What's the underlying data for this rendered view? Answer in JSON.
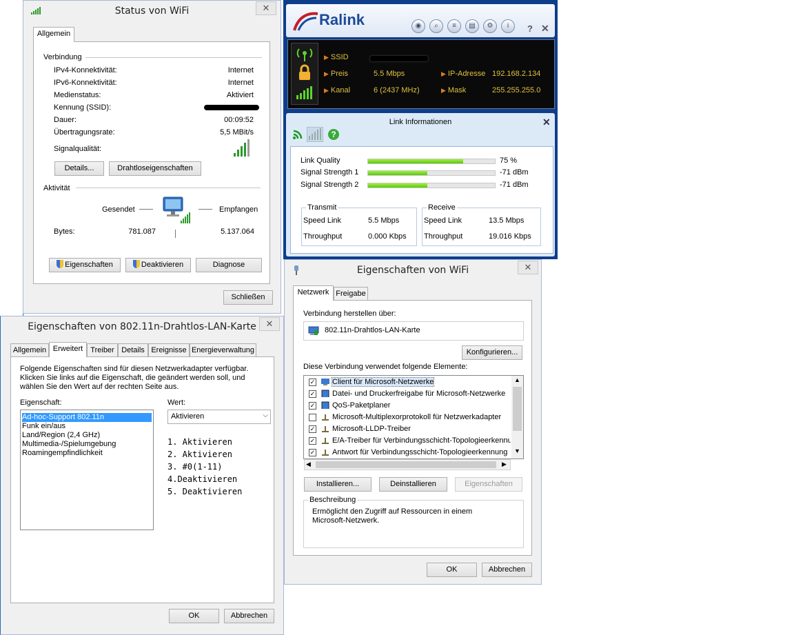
{
  "status_dialog": {
    "title": "Status von WiFi",
    "close": "✕",
    "tab": "Allgemein",
    "connection_heading": "Verbindung",
    "rows": [
      {
        "label": "IPv4-Konnektivität:",
        "value": "Internet"
      },
      {
        "label": "IPv6-Konnektivität:",
        "value": "Internet"
      },
      {
        "label": "Medienstatus:",
        "value": "Aktiviert"
      },
      {
        "label": "Kennung (SSID):",
        "value": ""
      },
      {
        "label": "Dauer:",
        "value": "00:09:52"
      },
      {
        "label": "Übertragungsrate:",
        "value": "5,5 MBit/s"
      }
    ],
    "signal_label": "Signalqualität:",
    "signal_bars": 4,
    "details_button": "Details...",
    "wireless_props_button": "Drahtloseigenschaften",
    "activity_heading": "Aktivität",
    "sent_label": "Gesendet",
    "received_label": "Empfangen",
    "bytes_label": "Bytes:",
    "bytes_sent": "781.087",
    "bytes_received": "5.137.064",
    "properties_button": "Eigenschaften",
    "disable_button": "Deaktivieren",
    "diagnose_button": "Diagnose",
    "close_button": "Schließen"
  },
  "ralink": {
    "brand": "Ralink",
    "toolbar_icons": [
      "rss-icon",
      "search-icon",
      "list-icon",
      "page-icon",
      "settings-icon",
      "info-icon"
    ],
    "help": "?",
    "close": "✕",
    "ssid_label": "SSID",
    "rate_label": "Preis",
    "rate_value": "5.5 Mbps",
    "ip_label": "IP-Adresse",
    "ip_value": "192.168.2.134",
    "channel_label": "Kanal",
    "channel_value": "6 (2437 MHz)",
    "mask_label": "Mask",
    "mask_value": "255.255.255.0",
    "link_title": "Link Informationen",
    "link_close": "✕",
    "link_quality_label": "Link Quality",
    "link_quality_value": "75 %",
    "link_quality_percent": 75,
    "signal1_label": "Signal Strength 1",
    "signal1_value": "-71 dBm",
    "signal1_percent": 47,
    "signal2_label": "Signal Strength 2",
    "signal2_value": "-71 dBm",
    "signal2_percent": 47,
    "transmit_caption": "Transmit",
    "receive_caption": "Receive",
    "speed_link_label": "Speed Link",
    "throughput_label": "Throughput",
    "tx_speed": "5.5 Mbps",
    "tx_throughput": "0.000 Kbps",
    "rx_speed": "13.5 Mbps",
    "rx_throughput": "19.016 Kbps"
  },
  "adapter_dialog": {
    "title": "Eigenschaften von 802.11n-Drahtlos-LAN-Karte",
    "close": "✕",
    "tabs": [
      "Allgemein",
      "Erweitert",
      "Treiber",
      "Details",
      "Ereignisse",
      "Energieverwaltung"
    ],
    "description": [
      "Folgende Eigenschaften sind für diesen Netzwerkadapter verfügbar.",
      "Klicken Sie links auf die Eigenschaft, die geändert werden soll, und",
      "wählen Sie den Wert auf der rechten Seite aus."
    ],
    "property_label": "Eigenschaft:",
    "value_label": "Wert:",
    "properties": [
      "Ad-hoc-Support 802.11n",
      "Funk ein/aus",
      "Land/Region (2,4 GHz)",
      "Multimedia-/Spielumgebung",
      "Roamingempfindlichkeit"
    ],
    "selected_value": "Aktivieren",
    "annotations": [
      "1. Aktivieren",
      "2. Aktivieren",
      "3. #0(1-11)",
      "4.Deaktivieren",
      "5. Deaktivieren"
    ],
    "ok_button": "OK",
    "cancel_button": "Abbrechen"
  },
  "wifi_props_dialog": {
    "title": "Eigenschaften von WiFi",
    "close": "✕",
    "tabs": [
      "Netzwerk",
      "Freigabe"
    ],
    "connect_using_label": "Verbindung herstellen über:",
    "adapter_name": "802.11n-Drahtlos-LAN-Karte",
    "configure_button": "Konfigurieren...",
    "items_label": "Diese Verbindung verwendet folgende Elemente:",
    "items": [
      {
        "label": "Client für Microsoft-Netzwerke",
        "checked": true,
        "icon": "network-client-icon"
      },
      {
        "label": "Datei- und Druckerfreigabe für Microsoft-Netzwerke",
        "checked": true,
        "icon": "network-service-icon"
      },
      {
        "label": "QoS-Paketplaner",
        "checked": true,
        "icon": "network-service-icon"
      },
      {
        "label": "Microsoft-Multiplexorprotokoll für Netzwerkadapter",
        "checked": false,
        "icon": "protocol-icon"
      },
      {
        "label": "Microsoft-LLDP-Treiber",
        "checked": true,
        "icon": "protocol-icon"
      },
      {
        "label": "E/A-Treiber für Verbindungsschicht-Topologieerkennung",
        "checked": true,
        "icon": "protocol-icon"
      },
      {
        "label": "Antwort für Verbindungsschicht-Topologieerkennung",
        "checked": true,
        "icon": "protocol-icon"
      }
    ],
    "install_button": "Installieren...",
    "uninstall_button": "Deinstallieren",
    "properties_button": "Eigenschaften",
    "description_caption": "Beschreibung",
    "description_text": [
      "Ermöglicht den Zugriff auf Ressourcen in einem",
      "Microsoft-Netzwerk."
    ],
    "ok_button": "OK",
    "cancel_button": "Abbrechen"
  }
}
